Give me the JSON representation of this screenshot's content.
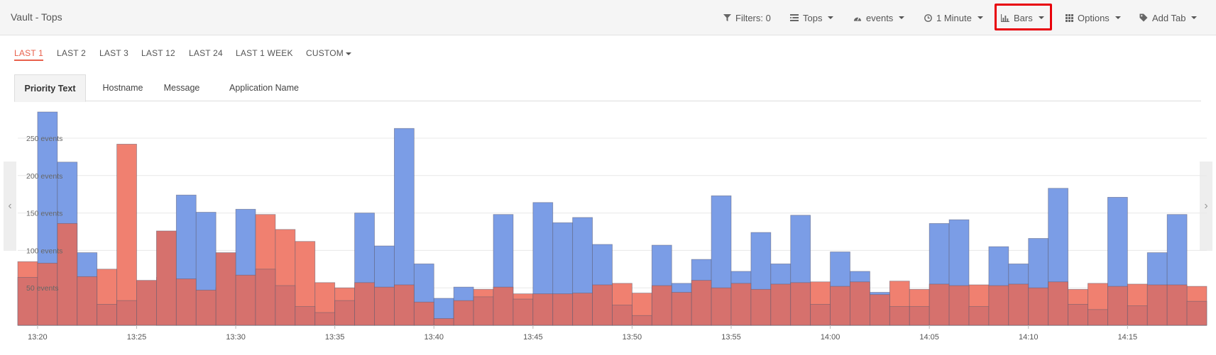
{
  "app": {
    "title": "Vault - Tops"
  },
  "toolbar": {
    "filters_label": "Filters: 0",
    "tops_label": "Tops",
    "events_label": "events",
    "interval_label": "1 Minute",
    "chart_type_label": "Bars",
    "options_label": "Options",
    "add_tab_label": "Add Tab"
  },
  "time_ranges": {
    "last1": "LAST 1",
    "last2": "LAST 2",
    "last3": "LAST 3",
    "last12": "LAST 12",
    "last24": "LAST 24",
    "last_week": "LAST 1 WEEK",
    "custom": "CUSTOM",
    "active": "LAST 1"
  },
  "tabs": {
    "priority_text": "Priority Text",
    "hostname": "Hostname",
    "message": "Message",
    "application_name": "Application Name",
    "active": "Priority Text"
  },
  "colors": {
    "accent": "#e8604c",
    "series_blue": "#7b9de6",
    "series_red": "#f08070",
    "highlight": "#e8000a"
  },
  "chart_data": {
    "type": "bar",
    "ylim": [
      0,
      285
    ],
    "y_ticks": [
      {
        "value": 50,
        "label": "50 events"
      },
      {
        "value": 100,
        "label": "100 events"
      },
      {
        "value": 150,
        "label": "150 events"
      },
      {
        "value": 200,
        "label": "200 events"
      },
      {
        "value": 250,
        "label": "250 events"
      }
    ],
    "x_ticks": [
      "13:20",
      "13:25",
      "13:30",
      "13:35",
      "13:40",
      "13:45",
      "13:50",
      "13:55",
      "14:00",
      "14:05",
      "14:10",
      "14:15"
    ],
    "series": [
      {
        "values": [
          null,
          285,
          218,
          97,
          null,
          null,
          null,
          64,
          174,
          151,
          null,
          155,
          null,
          null,
          null,
          null,
          null,
          150,
          106,
          263,
          82,
          36,
          51,
          null,
          148,
          null,
          164,
          137,
          144,
          108,
          null,
          null,
          107,
          56,
          88,
          173,
          72,
          124,
          82,
          147,
          null,
          98,
          72,
          44,
          null,
          null,
          136,
          141,
          null,
          105,
          82,
          116,
          183,
          null,
          null,
          171,
          null,
          97,
          148,
          null
        ]
      },
      {
        "values": [
          85,
          null,
          null,
          null,
          75,
          242,
          null,
          null,
          null,
          null,
          50,
          null,
          148,
          128,
          112,
          57,
          50,
          null,
          null,
          null,
          null,
          null,
          null,
          48,
          null,
          42,
          null,
          null,
          null,
          null,
          56,
          43,
          null,
          null,
          null,
          null,
          null,
          null,
          null,
          null,
          58,
          null,
          null,
          null,
          59,
          48,
          null,
          null,
          54,
          null,
          null,
          null,
          null,
          48,
          56,
          null,
          55,
          null,
          null,
          52
        ]
      },
      {
        "values": [
          64,
          83,
          136,
          65,
          28,
          33,
          60,
          126,
          62,
          47,
          97,
          67,
          75,
          53,
          25,
          17,
          33,
          57,
          51,
          54,
          31,
          9,
          33,
          38,
          51,
          35,
          42,
          42,
          43,
          54,
          27,
          13,
          53,
          44,
          60,
          50,
          56,
          48,
          55,
          57,
          28,
          52,
          58,
          41,
          25,
          25,
          55,
          53,
          25,
          53,
          55,
          50,
          58,
          28,
          21,
          52,
          26,
          54,
          54,
          32
        ]
      }
    ]
  }
}
